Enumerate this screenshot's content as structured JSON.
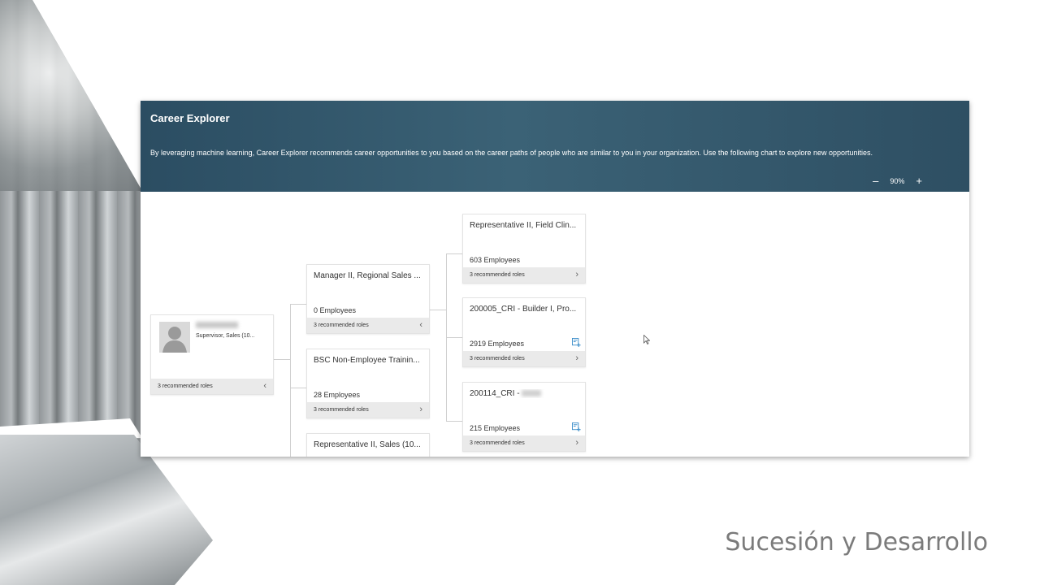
{
  "header": {
    "title": "Career Explorer",
    "description": "By leveraging machine learning, Career Explorer recommends career opportunities to you based on the career paths of people who are similar to you in your organization. Use the following chart to explore new opportunities.",
    "zoom_out": "–",
    "zoom_level": "90%",
    "zoom_in": "+"
  },
  "person": {
    "role": "Supervisor, Sales (10...",
    "roles_label": "3 recommended roles",
    "chevron": "‹"
  },
  "level1": [
    {
      "name": "Manager II, Regional Sales ...",
      "count": "0 Employees",
      "roles": "3 recommended roles",
      "chevron": "‹"
    },
    {
      "name": "BSC Non-Employee Trainin...",
      "count": "28 Employees",
      "roles": "3 recommended roles",
      "chevron": "›"
    },
    {
      "name": "Representative II, Sales (10..."
    }
  ],
  "level2": [
    {
      "name": "Representative II, Field Clin...",
      "count": "603 Employees",
      "roles": "3 recommended roles",
      "chevron": "›"
    },
    {
      "name": "200005_CRI - Builder I, Pro...",
      "count": "2919 Employees",
      "roles": "3 recommended roles",
      "chevron": "›"
    },
    {
      "name": "200114_CRI - ",
      "count": "215 Employees",
      "roles": "3 recommended roles",
      "chevron": "›"
    }
  ],
  "footer": {
    "title": "Sucesión y Desarrollo"
  }
}
